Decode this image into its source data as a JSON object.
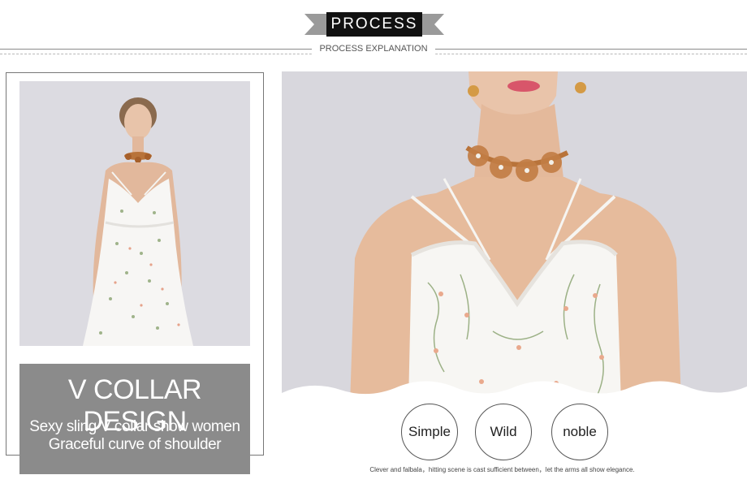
{
  "header": {
    "title": "PROCESS",
    "subtitle": "PROCESS EXPLANATION"
  },
  "left_panel": {
    "caption_title": "V COLLAR DESIGN",
    "caption_line_1": "Sexy sling V collar show women",
    "caption_line_2": "Graceful curve of shoulder"
  },
  "right_panel": {
    "badges": [
      "Simple",
      "Wild",
      "noble"
    ],
    "footnote": "Clever and falbala，hitting scene is cast sufficient between，let the arms all show elegance."
  },
  "colors": {
    "title_bg": "#111111",
    "caption_bg": "#8b8b8b",
    "photo_bg": "#d6d5db",
    "dress": "#f7f6f4",
    "choker": "#b8733a"
  },
  "icons": {
    "ribbon": "ribbon-tail-icon"
  }
}
